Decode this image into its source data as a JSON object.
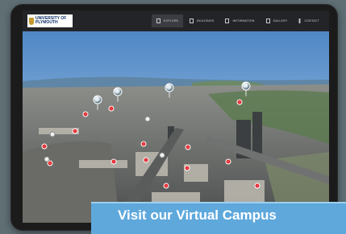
{
  "logo": {
    "line1": "UNIVERSITY OF",
    "line2": "PLYMOUTH"
  },
  "nav": {
    "items": [
      {
        "label": "EXPLORE",
        "active": true,
        "icon": "map-pin-icon"
      },
      {
        "label": "BUILDINGS",
        "active": false,
        "icon": "building-icon"
      },
      {
        "label": "INFORMATION",
        "active": false,
        "icon": "info-icon"
      },
      {
        "label": "GALLERY",
        "active": false,
        "icon": "gallery-icon"
      },
      {
        "label": "CONTACT",
        "active": false,
        "icon": "more-icon"
      }
    ]
  },
  "cta": {
    "label": "Visit our Virtual Campus"
  },
  "colors": {
    "accent": "#5ea8dc",
    "hotspot": "#e2262b",
    "topbar": "#232427"
  }
}
